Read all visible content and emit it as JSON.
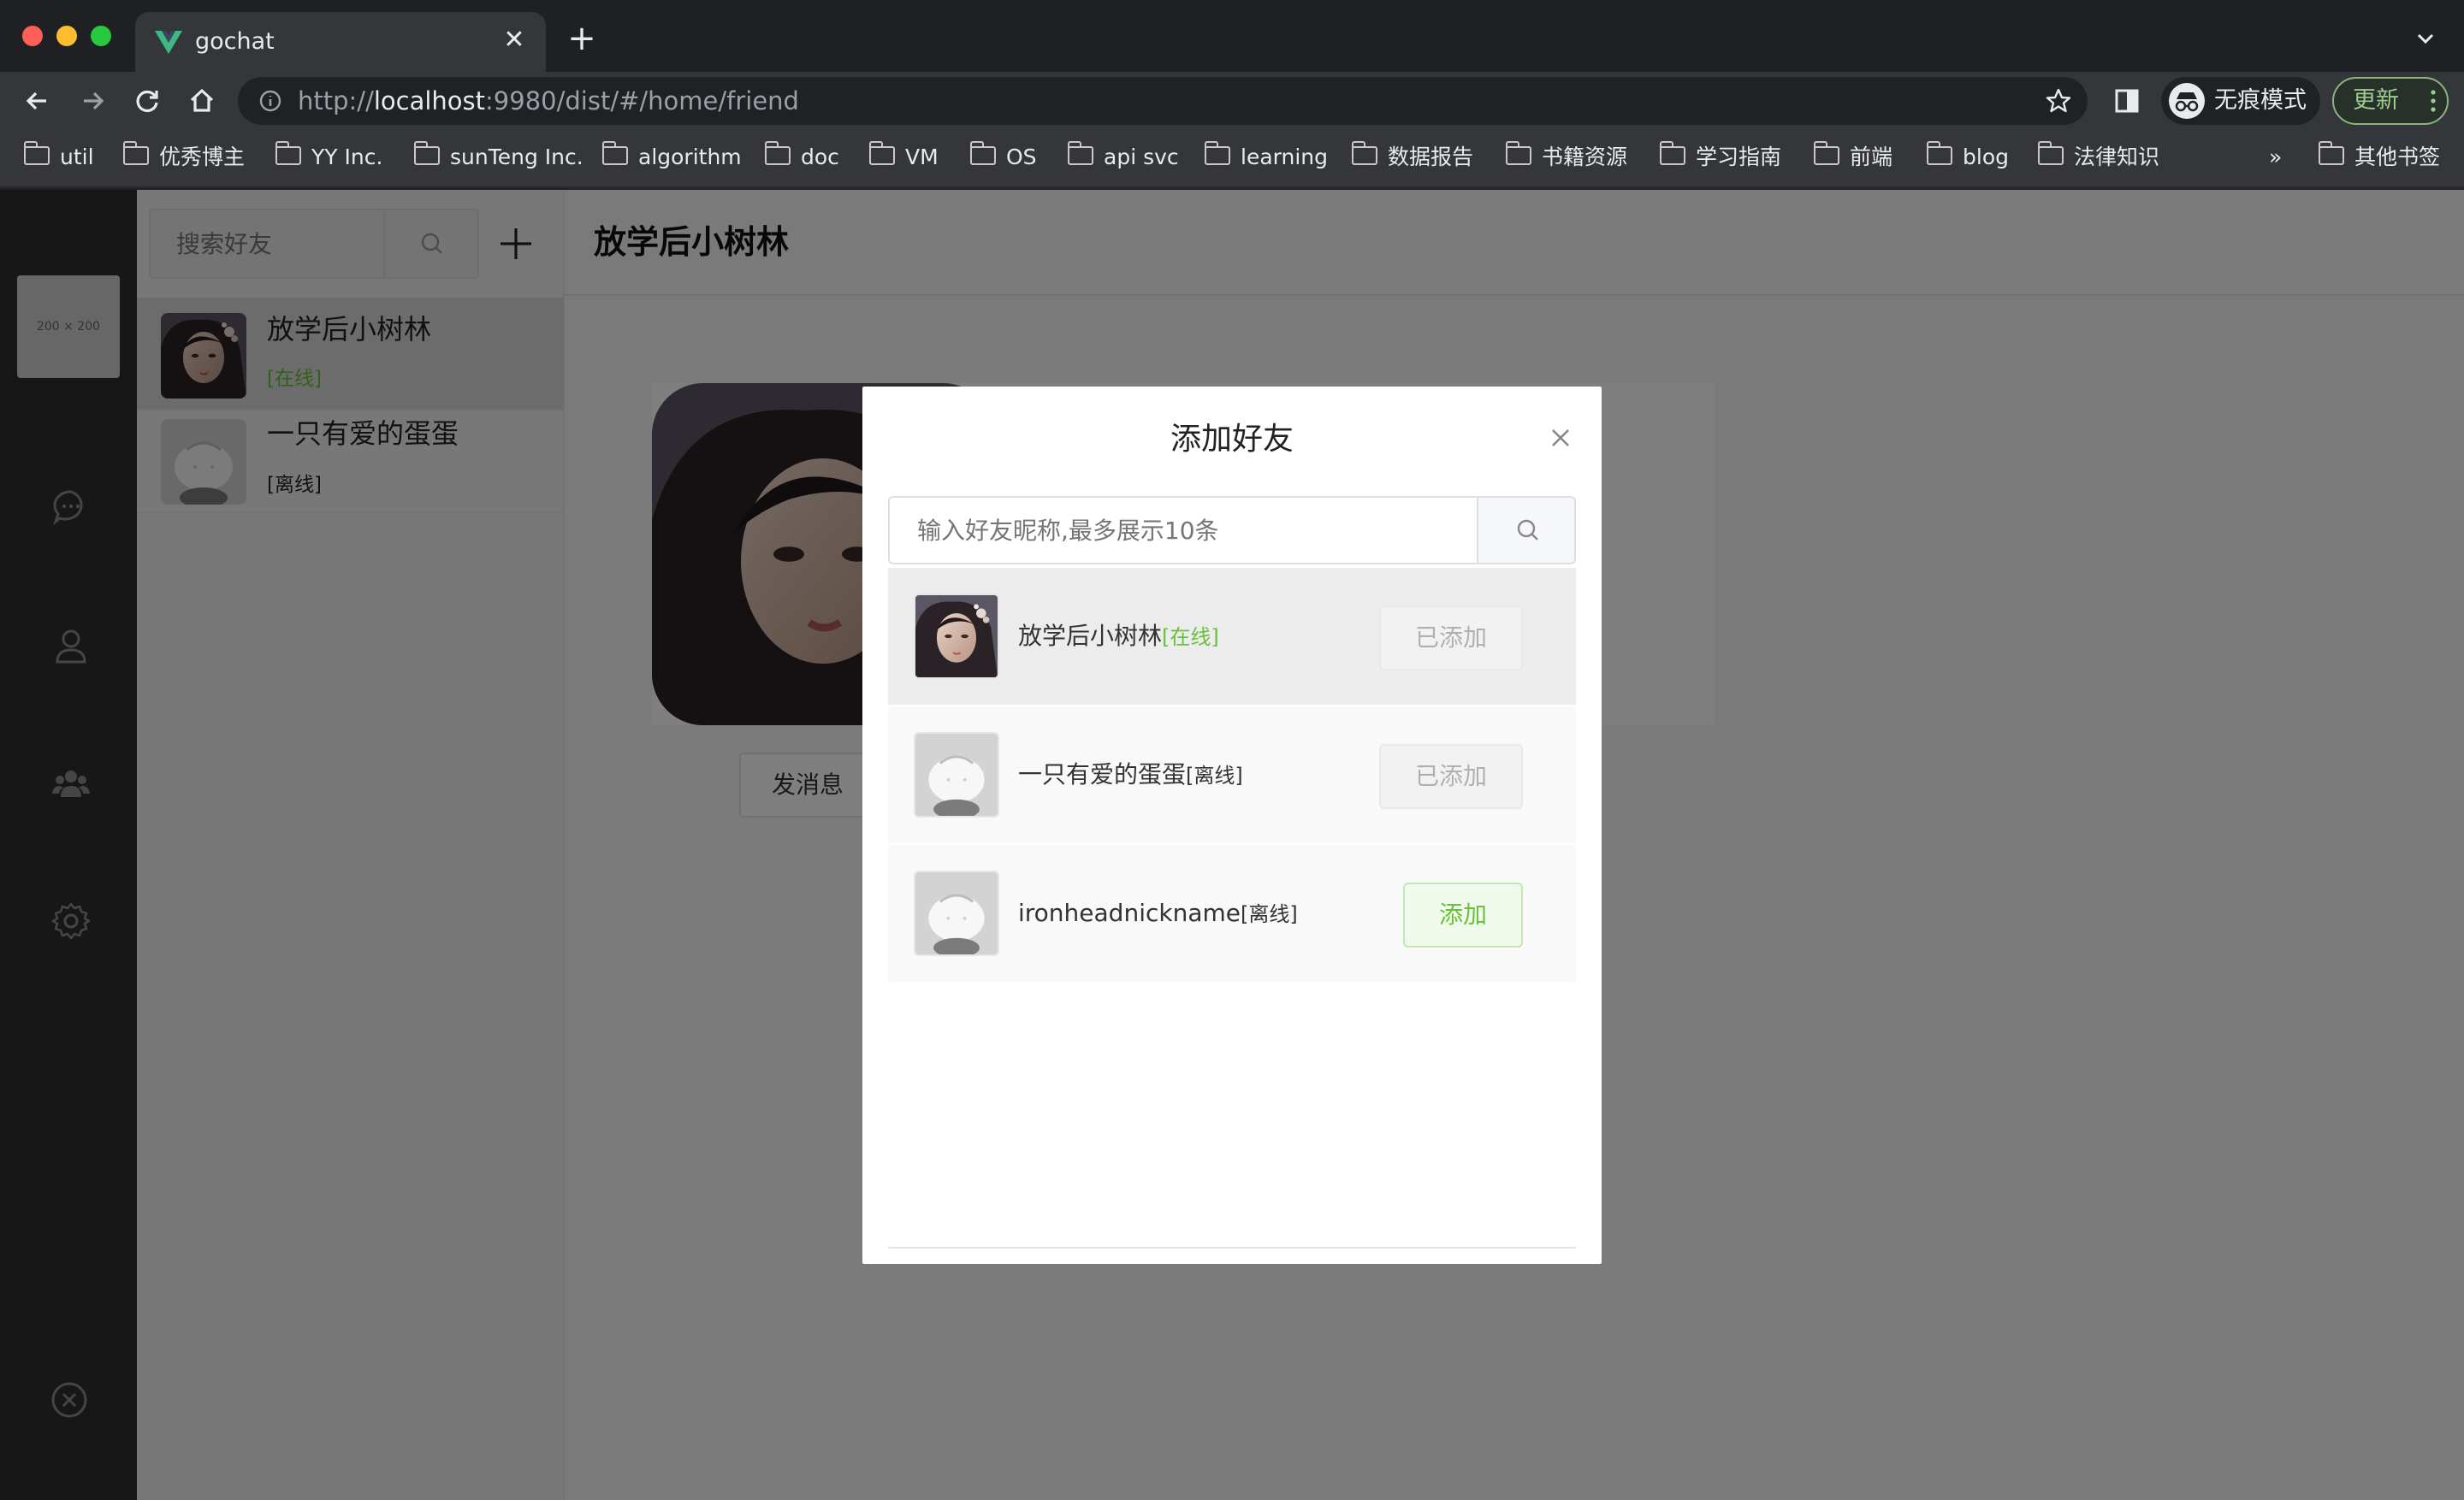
{
  "browser": {
    "tab_title": "gochat",
    "url_prefix": "http://",
    "url_host": "localhost",
    "url_rest": ":9980/dist/#/home/friend",
    "incognito_label": "无痕模式",
    "update_label": "更新",
    "overflow_label": "»",
    "bookmarks": [
      "util",
      "优秀博主",
      "YY Inc.",
      "sunTeng Inc.",
      "algorithm",
      "doc",
      "VM",
      "OS",
      "api svc",
      "learning",
      "数据报告",
      "书籍资源",
      "学习指南",
      "前端",
      "blog",
      "法律知识"
    ],
    "other_bookmarks": "其他书签"
  },
  "app": {
    "self_avatar_label": "200 × 200",
    "search": {
      "placeholder": "搜索好友"
    },
    "friends": [
      {
        "name": "放学后小树林",
        "status": "[在线]",
        "status_color": "#67c23a"
      },
      {
        "name": "一只有爱的蛋蛋",
        "status": "[离线]",
        "status_color": "#333333"
      }
    ],
    "main": {
      "title": "放学后小树林",
      "send_label": "发消息"
    }
  },
  "dialog": {
    "title": "添加好友",
    "search_placeholder": "输入好友昵称,最多展示10条",
    "results": [
      {
        "name": "放学后小树林",
        "status": "[在线]",
        "status_color": "#67c23a",
        "button": "已添加"
      },
      {
        "name": "一只有爱的蛋蛋",
        "status": "[离线]",
        "status_color": "#333333",
        "button": "已添加"
      },
      {
        "name": "ironheadnickname",
        "status": "[离线]",
        "status_color": "#333333",
        "button": "添加"
      }
    ]
  }
}
